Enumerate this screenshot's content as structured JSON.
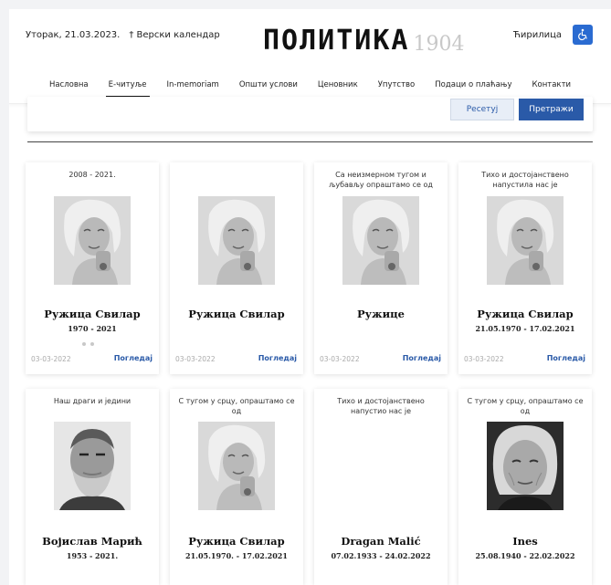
{
  "header": {
    "date": "Уторак, 21.03.2023.",
    "calendar_link": "† Верски календар",
    "logo_name": "ПОЛИТИКА",
    "logo_year": "1904",
    "script_switch": "Ћирилица",
    "accessibility_icon": "wheelchair-icon"
  },
  "nav": {
    "items": [
      "Насловна",
      "Е-читуље",
      "In-memoriam",
      "Општи услови",
      "Ценовник",
      "Упутство",
      "Подаци о плаћању",
      "Контакти"
    ],
    "active_index": 1
  },
  "filter": {
    "reset_label": "Ресетуј",
    "search_label": "Претражи"
  },
  "cards": [
    {
      "intro": "2008 - 2021.",
      "name": "Ружица Свилар",
      "dates": "1970 - 2021",
      "published": "03-03-2022",
      "view_label": "Погледај",
      "photo": "woman"
    },
    {
      "intro": "",
      "name": "Ружица Свилар",
      "dates": "",
      "published": "03-03-2022",
      "view_label": "Погледај",
      "photo": "woman"
    },
    {
      "intro": "Са неизмерном тугом и љубављу опраштамо се од",
      "name": "Ружице",
      "dates": "",
      "published": "03-03-2022",
      "view_label": "Погледај",
      "photo": "woman"
    },
    {
      "intro": "Тихо и достојанствено напустила нас је",
      "name": "Ружица Свилар",
      "dates": "21.05.1970 - 17.02.2021",
      "published": "03-03-2022",
      "view_label": "Погледај",
      "photo": "woman"
    },
    {
      "intro": "Наш драги и једини",
      "name": "Војислав Марић",
      "dates": "1953 - 2021.",
      "photo": "old-man"
    },
    {
      "intro": "С тугом у срцу, опраштамо се од",
      "name": "Ружица Свилар",
      "dates": "21.05.1970. - 17.02.2021",
      "photo": "woman"
    },
    {
      "intro": "Тихо и достојанствено напустио нас је",
      "name": "Dragan Malić",
      "dates": "07.02.1933 - 24.02.2022",
      "photo": "none"
    },
    {
      "intro": "С тугом у срцу, опраштамо се од",
      "name": "Ines",
      "dates": "25.08.1940 - 22.02.2022",
      "photo": "old-woman"
    }
  ],
  "colors": {
    "accent": "#2a5aa8",
    "accessibility": "#2a6bd1"
  }
}
